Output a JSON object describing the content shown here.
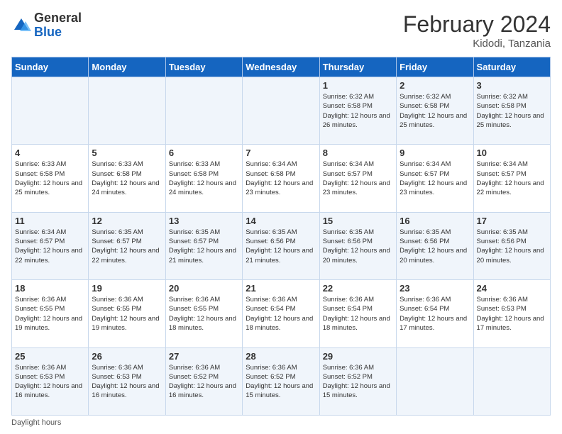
{
  "header": {
    "logo": {
      "general": "General",
      "blue": "Blue"
    },
    "title": "February 2024",
    "location": "Kidodi, Tanzania"
  },
  "days_of_week": [
    "Sunday",
    "Monday",
    "Tuesday",
    "Wednesday",
    "Thursday",
    "Friday",
    "Saturday"
  ],
  "weeks": [
    [
      {
        "day": "",
        "info": ""
      },
      {
        "day": "",
        "info": ""
      },
      {
        "day": "",
        "info": ""
      },
      {
        "day": "",
        "info": ""
      },
      {
        "day": "1",
        "info": "Sunrise: 6:32 AM\nSunset: 6:58 PM\nDaylight: 12 hours and 26 minutes."
      },
      {
        "day": "2",
        "info": "Sunrise: 6:32 AM\nSunset: 6:58 PM\nDaylight: 12 hours and 25 minutes."
      },
      {
        "day": "3",
        "info": "Sunrise: 6:32 AM\nSunset: 6:58 PM\nDaylight: 12 hours and 25 minutes."
      }
    ],
    [
      {
        "day": "4",
        "info": "Sunrise: 6:33 AM\nSunset: 6:58 PM\nDaylight: 12 hours and 25 minutes."
      },
      {
        "day": "5",
        "info": "Sunrise: 6:33 AM\nSunset: 6:58 PM\nDaylight: 12 hours and 24 minutes."
      },
      {
        "day": "6",
        "info": "Sunrise: 6:33 AM\nSunset: 6:58 PM\nDaylight: 12 hours and 24 minutes."
      },
      {
        "day": "7",
        "info": "Sunrise: 6:34 AM\nSunset: 6:58 PM\nDaylight: 12 hours and 23 minutes."
      },
      {
        "day": "8",
        "info": "Sunrise: 6:34 AM\nSunset: 6:57 PM\nDaylight: 12 hours and 23 minutes."
      },
      {
        "day": "9",
        "info": "Sunrise: 6:34 AM\nSunset: 6:57 PM\nDaylight: 12 hours and 23 minutes."
      },
      {
        "day": "10",
        "info": "Sunrise: 6:34 AM\nSunset: 6:57 PM\nDaylight: 12 hours and 22 minutes."
      }
    ],
    [
      {
        "day": "11",
        "info": "Sunrise: 6:34 AM\nSunset: 6:57 PM\nDaylight: 12 hours and 22 minutes."
      },
      {
        "day": "12",
        "info": "Sunrise: 6:35 AM\nSunset: 6:57 PM\nDaylight: 12 hours and 22 minutes."
      },
      {
        "day": "13",
        "info": "Sunrise: 6:35 AM\nSunset: 6:57 PM\nDaylight: 12 hours and 21 minutes."
      },
      {
        "day": "14",
        "info": "Sunrise: 6:35 AM\nSunset: 6:56 PM\nDaylight: 12 hours and 21 minutes."
      },
      {
        "day": "15",
        "info": "Sunrise: 6:35 AM\nSunset: 6:56 PM\nDaylight: 12 hours and 20 minutes."
      },
      {
        "day": "16",
        "info": "Sunrise: 6:35 AM\nSunset: 6:56 PM\nDaylight: 12 hours and 20 minutes."
      },
      {
        "day": "17",
        "info": "Sunrise: 6:35 AM\nSunset: 6:56 PM\nDaylight: 12 hours and 20 minutes."
      }
    ],
    [
      {
        "day": "18",
        "info": "Sunrise: 6:36 AM\nSunset: 6:55 PM\nDaylight: 12 hours and 19 minutes."
      },
      {
        "day": "19",
        "info": "Sunrise: 6:36 AM\nSunset: 6:55 PM\nDaylight: 12 hours and 19 minutes."
      },
      {
        "day": "20",
        "info": "Sunrise: 6:36 AM\nSunset: 6:55 PM\nDaylight: 12 hours and 18 minutes."
      },
      {
        "day": "21",
        "info": "Sunrise: 6:36 AM\nSunset: 6:54 PM\nDaylight: 12 hours and 18 minutes."
      },
      {
        "day": "22",
        "info": "Sunrise: 6:36 AM\nSunset: 6:54 PM\nDaylight: 12 hours and 18 minutes."
      },
      {
        "day": "23",
        "info": "Sunrise: 6:36 AM\nSunset: 6:54 PM\nDaylight: 12 hours and 17 minutes."
      },
      {
        "day": "24",
        "info": "Sunrise: 6:36 AM\nSunset: 6:53 PM\nDaylight: 12 hours and 17 minutes."
      }
    ],
    [
      {
        "day": "25",
        "info": "Sunrise: 6:36 AM\nSunset: 6:53 PM\nDaylight: 12 hours and 16 minutes."
      },
      {
        "day": "26",
        "info": "Sunrise: 6:36 AM\nSunset: 6:53 PM\nDaylight: 12 hours and 16 minutes."
      },
      {
        "day": "27",
        "info": "Sunrise: 6:36 AM\nSunset: 6:52 PM\nDaylight: 12 hours and 16 minutes."
      },
      {
        "day": "28",
        "info": "Sunrise: 6:36 AM\nSunset: 6:52 PM\nDaylight: 12 hours and 15 minutes."
      },
      {
        "day": "29",
        "info": "Sunrise: 6:36 AM\nSunset: 6:52 PM\nDaylight: 12 hours and 15 minutes."
      },
      {
        "day": "",
        "info": ""
      },
      {
        "day": "",
        "info": ""
      }
    ]
  ],
  "footer": {
    "note": "Daylight hours"
  }
}
